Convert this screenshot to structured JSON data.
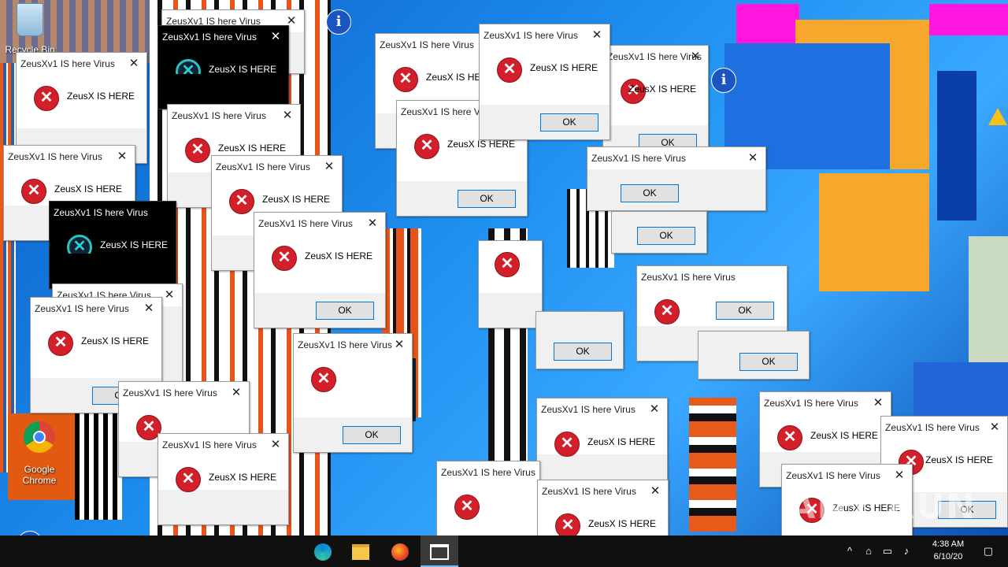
{
  "desktop": {
    "recycle_bin_label": "Recycle Bin",
    "chrome_label": "Google Chrome",
    "watermark": "ANY RUN"
  },
  "dialog": {
    "title": "ZeusXv1 IS here Virus",
    "message": "ZeusX IS HERE",
    "ok_label": "OK",
    "close_glyph": "✕"
  },
  "icons": {
    "error": "error-x-icon",
    "info": "info-icon",
    "warning": "warning-icon"
  },
  "taskbar": {
    "apps": [
      "edge-icon",
      "file-explorer-icon",
      "firefox-icon",
      "window-app-icon"
    ],
    "clock_time": "4:38 AM",
    "clock_date": "6/10/20"
  },
  "colors": {
    "error_red": "#d21f2a",
    "ok_border": "#0078d7",
    "taskbar": "#101010"
  }
}
